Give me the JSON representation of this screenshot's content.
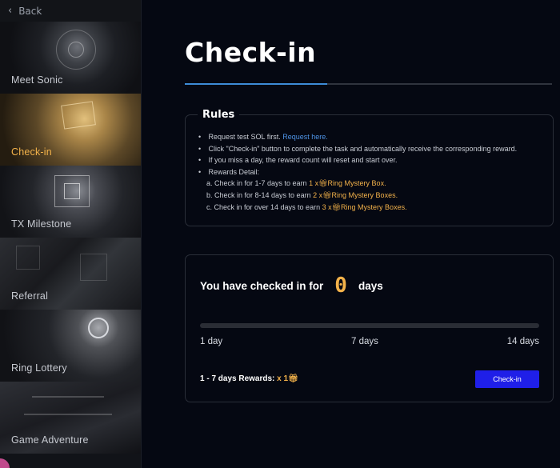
{
  "sidebar": {
    "back_label": "Back",
    "items": [
      {
        "label": "Meet Sonic",
        "active": false
      },
      {
        "label": "Check-in",
        "active": true
      },
      {
        "label": "TX Milestone",
        "active": false
      },
      {
        "label": "Referral",
        "active": false
      },
      {
        "label": "Ring Lottery",
        "active": false
      },
      {
        "label": "Game Adventure",
        "active": false
      }
    ]
  },
  "page": {
    "title": "Check-in"
  },
  "rules": {
    "title": "Rules",
    "line1_text": "Request test SOL first.",
    "line1_link": "Request here.",
    "line2": "Click \"Check-in\" button to complete the task and automatically receive the corresponding reward.",
    "line3": "If you miss a day, the reward count will reset and start over.",
    "line4": "Rewards Detail:",
    "tier_a_text": "a. Check in for 1-7 days to earn",
    "tier_a_reward": "1 x",
    "tier_a_item": "Ring Mystery Box.",
    "tier_b_text": "b. Check in for 8-14 days to earn",
    "tier_b_reward": "2 x",
    "tier_b_item": "Ring Mystery Boxes.",
    "tier_c_text": "c. Check in for over 14 days to earn",
    "tier_c_reward": "3 x",
    "tier_c_item": "Ring Mystery Boxes."
  },
  "checkin": {
    "prefix": "You have checked in for",
    "days": "0",
    "suffix": "days",
    "progress_fraction": 0,
    "milestones": [
      "1 day",
      "7 days",
      "14 days"
    ],
    "reward_label": "1 - 7 days Rewards:",
    "reward_value": "x 1",
    "button_label": "Check-in"
  },
  "icons": {
    "back": "chevron-left-icon",
    "bullet": "bullet-icon",
    "reward": "gift-box-icon"
  },
  "colors": {
    "background": "#050812",
    "accent_gold": "#f3b24a",
    "link_blue": "#4e93e6",
    "button_blue": "#1f1fe8",
    "tab_active": "#3d8bd6"
  }
}
